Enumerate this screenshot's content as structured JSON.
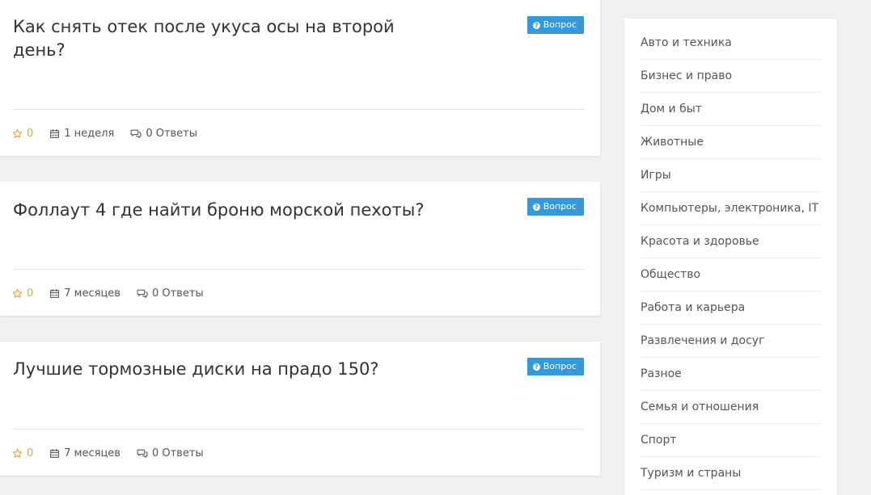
{
  "questions": [
    {
      "title": "Как снять отек после укуса осы на второй день?",
      "badge": "Вопрос",
      "votes": "0",
      "time": "1 неделя",
      "answers": "0 Ответы"
    },
    {
      "title": "Фоллаут 4 где найти броню морской пехоты?",
      "badge": "Вопрос",
      "votes": "0",
      "time": "7 месяцев",
      "answers": "0 Ответы"
    },
    {
      "title": "Лучшие тормозные диски на прадо 150?",
      "badge": "Вопрос",
      "votes": "0",
      "time": "7 месяцев",
      "answers": "0 Ответы"
    }
  ],
  "sidebar": {
    "categories": [
      "Авто и техника",
      "Бизнес и право",
      "Дом и быт",
      "Животные",
      "Игры",
      "Компьютеры, электроника, IT",
      "Красота и здоровье",
      "Общество",
      "Работа и карьера",
      "Развлечения и досуг",
      "Разное",
      "Семья и отношения",
      "Спорт",
      "Туризм и страны"
    ]
  },
  "icons": {
    "badge": "question-circle-icon",
    "votes": "star-outline-icon",
    "time": "calendar-icon",
    "answers": "comments-icon"
  },
  "colors": {
    "badge_background": "#3498db",
    "votes_color": "#e6a23c",
    "page_background": "#f1f1f1"
  }
}
